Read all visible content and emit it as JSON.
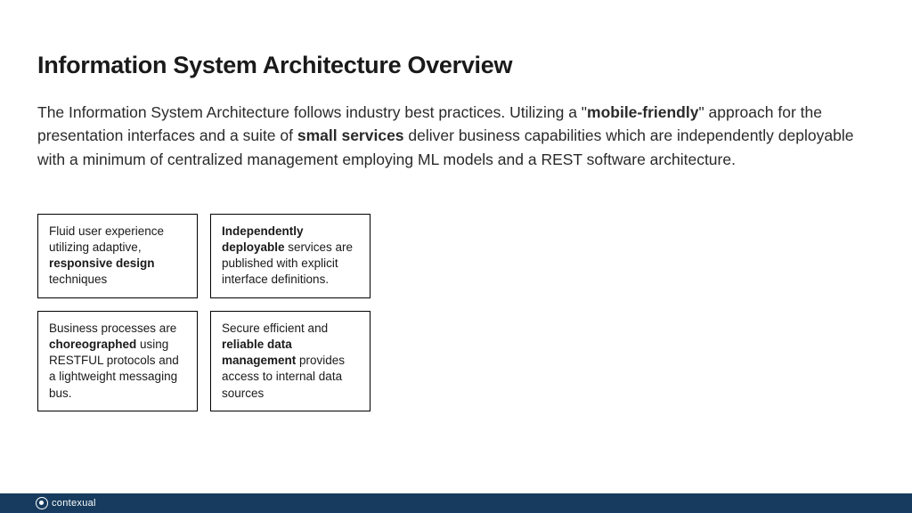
{
  "title": "Information System Architecture Overview",
  "intro": {
    "part1": "The Information System Architecture follows industry best practices. Utilizing a \"",
    "bold1": "mobile-friendly",
    "part2": "\" approach for the presentation interfaces and a suite of ",
    "bold2": "small services",
    "part3": " deliver business capabilities which are independently deployable with a minimum of centralized management employing ML models and a REST software architecture."
  },
  "boxes": [
    {
      "pre": "Fluid user experience utilizing adaptive, ",
      "bold": "responsive design",
      "post": " techniques"
    },
    {
      "pre": "",
      "bold": "Independently deployable",
      "post": " services are published with explicit interface definitions."
    },
    {
      "pre": "Business processes are ",
      "bold": "choreographed",
      "post": " using RESTFUL protocols and a lightweight messaging bus."
    },
    {
      "pre": "Secure efficient and ",
      "bold": "reliable data management",
      "post": " provides access to internal data sources"
    }
  ],
  "footer": {
    "brand": "contexual"
  }
}
